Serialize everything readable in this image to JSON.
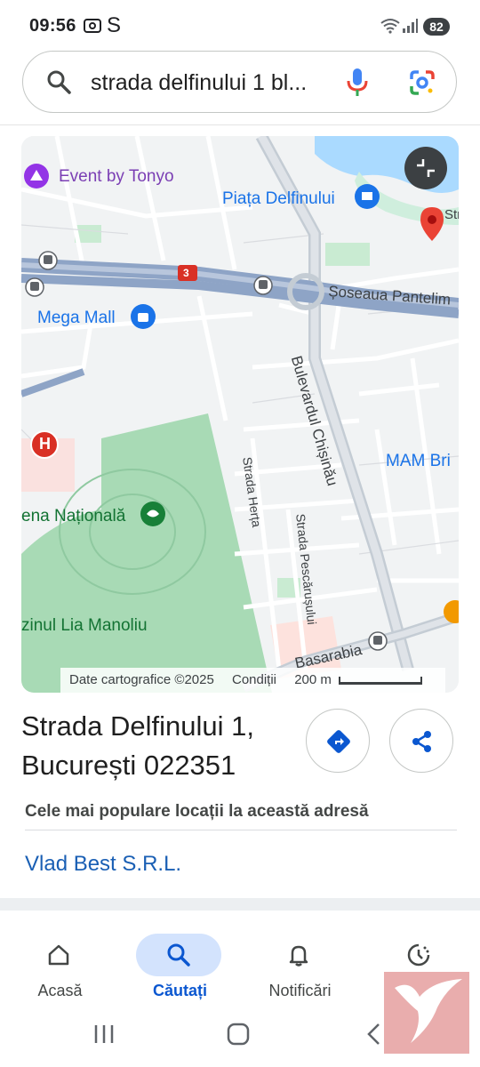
{
  "status_bar": {
    "time": "09:56",
    "s_glyph": "S",
    "battery": "82"
  },
  "search": {
    "query": "strada delfinului 1 bl...",
    "icons": [
      "search-icon",
      "mic-icon",
      "lens-icon"
    ]
  },
  "map": {
    "labels": {
      "event": "Event by Tonyo",
      "piata": "Piața Delfinului",
      "mega": "Mega Mall",
      "soseaua": "Șoseaua Pantelim",
      "str_edge": "Str",
      "bulevard": "Bulevardul Chișinău",
      "mam": "MAM Bri",
      "arena": "ena Națională",
      "herta": "Strada Herța",
      "pescarusului": "Strada Pescărușului",
      "lia": "zinul Lia Manoliu",
      "basarabia": "Basarabia",
      "route": "3"
    },
    "attribution": {
      "data": "Date cartografice ©2025",
      "terms": "Condiții",
      "scale": "200 m"
    }
  },
  "place": {
    "line1": "Strada Delfinului 1,",
    "line2": "București 022351",
    "popular_title": "Cele mai populare locații la această adresă",
    "business": "Vlad Best S.R.L."
  },
  "bottom_nav": [
    {
      "label": "Acasă",
      "icon": "home-icon"
    },
    {
      "label": "Căutați",
      "icon": "search-icon",
      "active": true
    },
    {
      "label": "Notificări",
      "icon": "bell-icon"
    },
    {
      "label": "",
      "icon": "history-icon"
    }
  ],
  "colors": {
    "accent": "#1a73e8",
    "active_pill": "#d3e3fd",
    "park": "#a8dab5",
    "pin": "#ea4335"
  }
}
